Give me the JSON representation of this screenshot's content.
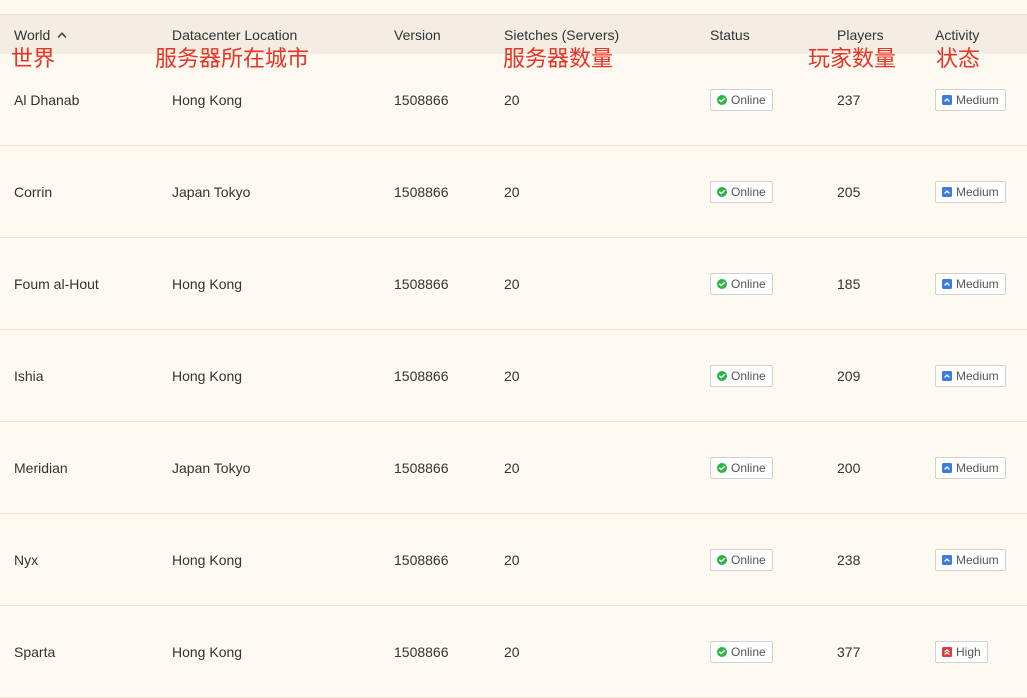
{
  "header": {
    "columns": [
      "World",
      "Datacenter Location",
      "Version",
      "Sietches (Servers)",
      "Status",
      "Players",
      "Activity"
    ]
  },
  "annotations": [
    "世界",
    "服务器所在城市",
    "服务器数量",
    "玩家数量",
    "状态"
  ],
  "rows": [
    {
      "world": "Al Dhanab",
      "location": "Hong Kong",
      "version": "1508866",
      "servers": "20",
      "status": "Online",
      "players": "237",
      "activity": "Medium",
      "activity_color": "#3b7ddd"
    },
    {
      "world": "Corrin",
      "location": "Japan Tokyo",
      "version": "1508866",
      "servers": "20",
      "status": "Online",
      "players": "205",
      "activity": "Medium",
      "activity_color": "#3b7ddd"
    },
    {
      "world": "Foum al-Hout",
      "location": "Hong Kong",
      "version": "1508866",
      "servers": "20",
      "status": "Online",
      "players": "185",
      "activity": "Medium",
      "activity_color": "#3b7ddd"
    },
    {
      "world": "Ishia",
      "location": "Hong Kong",
      "version": "1508866",
      "servers": "20",
      "status": "Online",
      "players": "209",
      "activity": "Medium",
      "activity_color": "#3b7ddd"
    },
    {
      "world": "Meridian",
      "location": "Japan Tokyo",
      "version": "1508866",
      "servers": "20",
      "status": "Online",
      "players": "200",
      "activity": "Medium",
      "activity_color": "#3b7ddd"
    },
    {
      "world": "Nyx",
      "location": "Hong Kong",
      "version": "1508866",
      "servers": "20",
      "status": "Online",
      "players": "238",
      "activity": "Medium",
      "activity_color": "#3b7ddd"
    },
    {
      "world": "Sparta",
      "location": "Hong Kong",
      "version": "1508866",
      "servers": "20",
      "status": "Online",
      "players": "377",
      "activity": "High",
      "activity_color": "#e0393e"
    }
  ],
  "colors": {
    "online": "#2bb34a",
    "annotation": "#ea3323"
  },
  "icons": {
    "sort": "chevron-up-icon",
    "status": "check-circle-icon",
    "activity_medium": "arrow-up-icon",
    "activity_high": "double-arrow-up-icon"
  }
}
